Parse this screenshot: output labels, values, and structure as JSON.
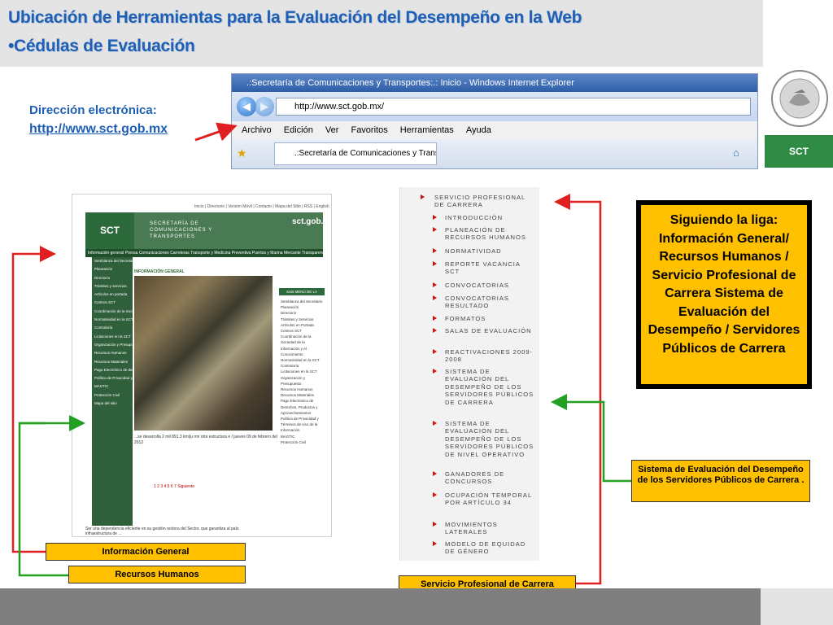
{
  "header": {
    "title_line1": "Ubicación de Herramientas para la Evaluación del Desempeño en la Web",
    "title_line2": "•Cédulas de Evaluación"
  },
  "address": {
    "label": "Dirección electrónica:",
    "url": "http://www.sct.gob.mx"
  },
  "logo": {
    "badge": "SCT",
    "seal_text": "ESTADOS UNIDOS MEXICANOS"
  },
  "browser": {
    "window_title": ".:Secretaría de Comunicaciones y Transportes:.: Inicio - Windows Internet Explorer",
    "address_value": "http://www.sct.gob.mx/",
    "menu": [
      "Archivo",
      "Edición",
      "Ver",
      "Favoritos",
      "Herramientas",
      "Ayuda"
    ],
    "tab_title": ".:Secretaría de Comunicaciones y Transportes:.: Inicio"
  },
  "site": {
    "topline": "Inicio | Directorio | Versión Móvil | Contacto | Mapa del Sitio | RSS | English",
    "logo": "SCT",
    "secretaria": "SECRETARÍA DE COMUNICACIONES Y TRANSPORTES",
    "domain": "sct.gob.mx",
    "nav": "Información general   Prensa   Comunicaciones   Carreteras   Transporte y Medicina Preventiva   Puertos y Marina Mercante   Transparencia",
    "dropdown": [
      "Semblanza del Secretario",
      "Planeación",
      "Directorio",
      "Trámites y servicios",
      "Artículos en portada",
      "Centros SCT",
      "Coordinación de la Sociedad de la Información y el Conocimiento",
      "Normatividad en la SCT",
      "Contraloría",
      "Licitaciones en la SCT",
      "Organización y Presupuesto",
      "Recursos Humanos",
      "Recursos Materiales",
      "Pago Electrónico de derechos, productos y aprovechamientos",
      "Política de Privacidad y Términos de uso de la información",
      "MAGTIC",
      "Protección Civil",
      "Mapa del sitio"
    ],
    "photo_title": "INFORMACIÓN GENERAL",
    "caption": "...se desarrolla 2 mil 891.3 km/ju rmi otra estructura e / jueves 09 de febrero del 2012",
    "pages": "1 2 3 4 5 6 7  Siguiente",
    "right_heading": "SUB MENÚ DE LA SECCIÓN",
    "right_items": [
      "Semblanza del Secretario",
      "Planeación",
      "Directorio",
      "Trámites y Servicios",
      "Artículos en Portada",
      "Centros SCT",
      "Coordinación de la Sociedad de la Información y el Conocimiento",
      "Normatividad en la SCT",
      "Contraloría",
      "Licitaciones en la SCT",
      "Organización y Presupuesto",
      "Recursos Humanos",
      "Recursos Materiales",
      "Pago Electrónico de Derechos, Productos y Aprovechamientos",
      "Política de Privacidad y Términos de Uso de la Información",
      "MAGTIC",
      "Protección Civil"
    ],
    "footer": "Ser una dependencia eficiente en su gestión rectora del Sector, que garantiza al país infraestructura de ..."
  },
  "menu": {
    "heading": "SERVICIO PROFESIONAL DE CARRERA",
    "items": [
      "INTRODUCCIÓN",
      "PLANEACIÓN DE RECURSOS HUMANOS",
      "NORMATIVIDAD",
      "REPORTE VACANCIA SCT",
      "CONVOCATORIAS",
      "CONVOCATORIAS RESULTADO",
      "FORMATOS",
      "SALAS DE EVALUACIÓN",
      "REACTIVACIONES 2009-2008",
      "SISTEMA DE EVALUACIÓN DEL DESEMPEÑO DE LOS SERVIDORES PÚBLICOS DE CARRERA",
      "SISTEMA DE EVALUACIÓN DEL DESEMPEÑO DE LOS SERVIDORES PÚBLICOS DE NIVEL OPERATIVO",
      "GANADORES DE CONCURSOS",
      "OCUPACIÓN TEMPORAL POR ARTÍCULO 34",
      "MOVIMIENTOS LATERALES",
      "MODELO DE EQUIDAD DE GÉNERO"
    ]
  },
  "callouts": {
    "info_general": "Información General",
    "recursos_humanos": "Recursos Humanos",
    "servicio_profesional": "Servicio Profesional de Carrera",
    "sistema_evaluacion": "Sistema de Evaluación del Desempeño de los Servidores Públicos de Carrera .",
    "siguiendo_liga": "Siguiendo la liga: Información General/ Recursos Humanos / Servicio Profesional de Carrera Sistema de Evaluación del Desempeño / Servidores Públicos de Carrera"
  },
  "colors": {
    "title_blue": "#1f5fb4",
    "callout_yellow": "#ffc000",
    "arrow_red": "#e02020",
    "arrow_green": "#22a022",
    "sct_green": "#2f8a43"
  }
}
